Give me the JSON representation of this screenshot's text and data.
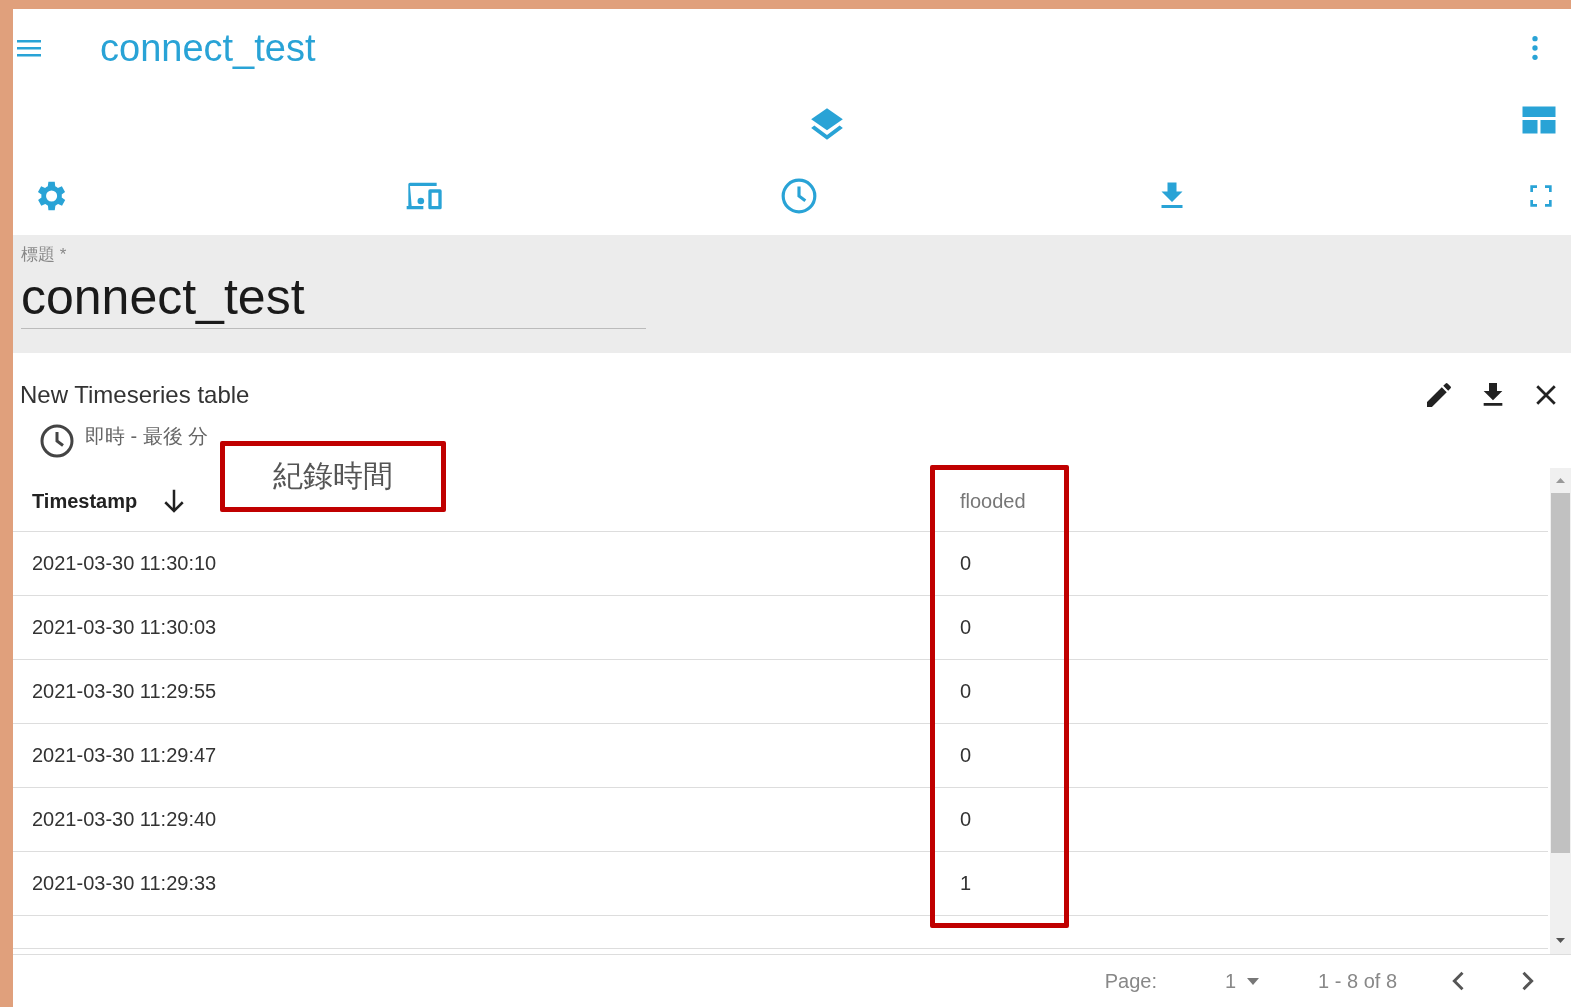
{
  "app_bar": {
    "title": "connect_test"
  },
  "title_field": {
    "label": "標題",
    "required_mark": "*",
    "value": "connect_test"
  },
  "widget": {
    "title": "New Timeseries table",
    "timewindow": "即時 - 最後 分",
    "columns": [
      {
        "label": "Timestamp",
        "sorted": true
      },
      {
        "label": "flooded",
        "sorted": false
      }
    ],
    "rows": [
      [
        "2021-03-30 11:30:10",
        "0"
      ],
      [
        "2021-03-30 11:30:03",
        "0"
      ],
      [
        "2021-03-30 11:29:55",
        "0"
      ],
      [
        "2021-03-30 11:29:47",
        "0"
      ],
      [
        "2021-03-30 11:29:40",
        "0"
      ],
      [
        "2021-03-30 11:29:33",
        "1"
      ]
    ],
    "pagination": {
      "page_label": "Page:",
      "page": "1",
      "range": "1 - 8 of 8"
    }
  },
  "annotations": [
    {
      "kind": "label",
      "text": "紀錄時間"
    },
    {
      "kind": "highlight"
    }
  ]
}
